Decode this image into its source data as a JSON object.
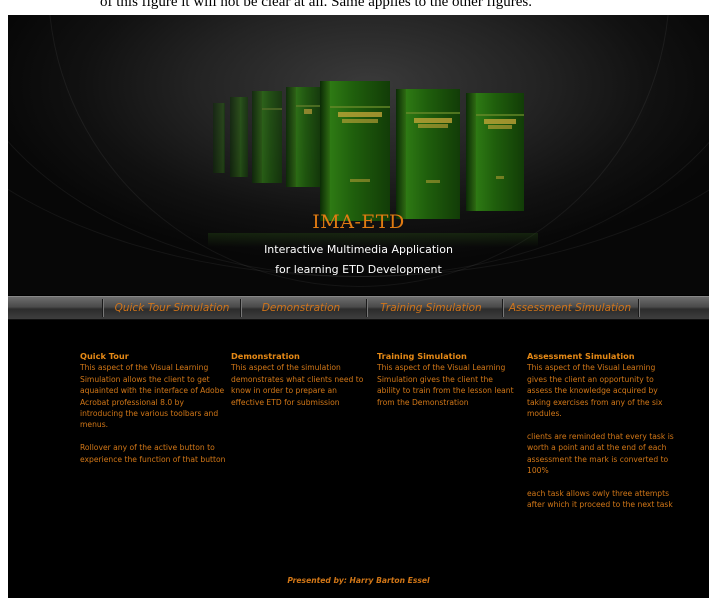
{
  "caption": "of this figure it will not be clear at all. Same applies to the other figures.",
  "header": {
    "title": "IMA-ETD",
    "subtitle_line1": "Interactive Multimedia Application",
    "subtitle_line2": "for learning ETD Development"
  },
  "nav": [
    {
      "label": "Quick Tour Simulation"
    },
    {
      "label": "Demonstration"
    },
    {
      "label": "Training Simulation"
    },
    {
      "label": "Assessment Simulation"
    }
  ],
  "columns": [
    {
      "heading": "Quick Tour",
      "paragraphs": [
        "This aspect of the Visual Learning Simulation allows the client to get aquainted with the interface of Adobe Acrobat professional 8.0 by introducing the various toolbars and menus.",
        "Rollover any of the active button to experience the function of that button"
      ]
    },
    {
      "heading": "Demonstration",
      "paragraphs": [
        "This aspect of the simulation demonstrates what clients need to know in order to prepare an effective ETD for submission"
      ]
    },
    {
      "heading": "Training Simulation",
      "paragraphs": [
        "This aspect of the Visual Learning Simulation gives the client the ability to train from the lesson leant from the Demonstration"
      ]
    },
    {
      "heading": "Assessment Simulation",
      "paragraphs": [
        "This aspect of the Visual Learning gives the client an opportunity to assess the knowledge acquired by taking exercises from any of the six modules.",
        "clients are reminded that every task is worth a point and at the end of each assessment the mark is converted to 100%",
        "each task allows owly three attempts after which it proceed to the next task"
      ]
    }
  ],
  "footer": "Presented by: Harry Barton Essel",
  "colors": {
    "accent_orange": "#e07b12",
    "body_text": "#d27717",
    "background": "#000000",
    "book_green": "#2e7a14"
  }
}
